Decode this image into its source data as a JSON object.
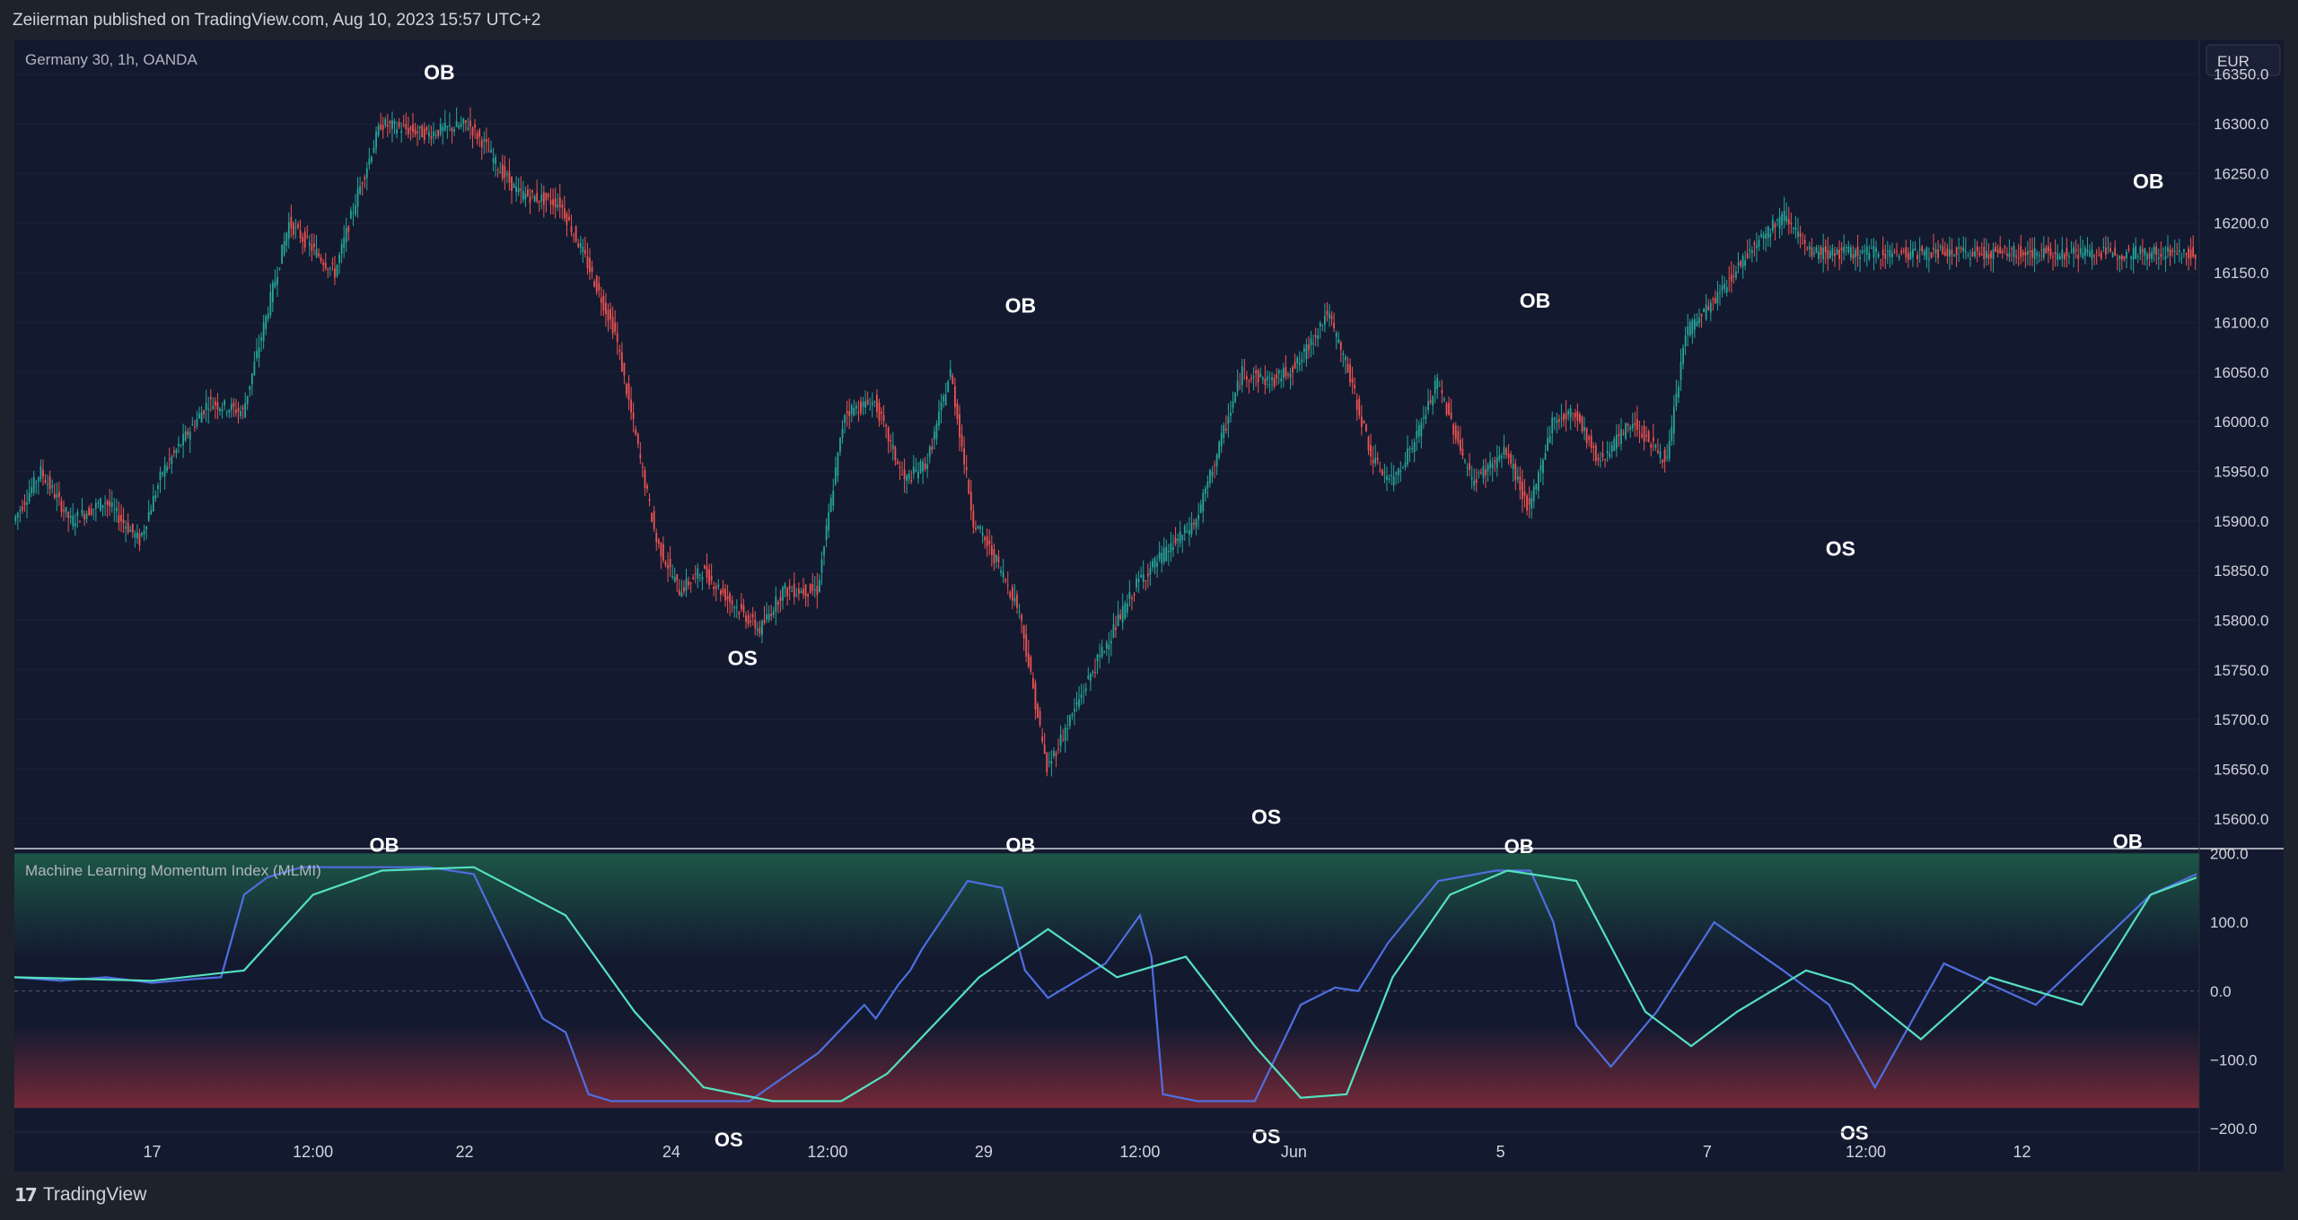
{
  "header": {
    "text": "Zeiierman published on TradingView.com, Aug 10, 2023 15:57 UTC+2"
  },
  "footer": {
    "brand": "TradingView",
    "logo_icon": "tv-logo-icon"
  },
  "colors": {
    "bg": "#131a30",
    "frame": "#1e222d",
    "text": "#d1d4dc",
    "up": "#26a69a",
    "down": "#ef5350",
    "mlmi_fast": "#4f6ee0",
    "mlmi_slow": "#55e0c0",
    "ob_zone": "#1d5a48",
    "os_zone": "#7a2a38"
  },
  "chart_data": [
    {
      "type": "candlestick",
      "title": "Germany 30, 1h, OANDA",
      "currency": "EUR",
      "ylim": [
        15570,
        16385
      ],
      "yticks": [
        "16350.0",
        "16300.0",
        "16250.0",
        "16200.0",
        "16150.0",
        "16100.0",
        "16050.0",
        "16000.0",
        "15950.0",
        "15900.0",
        "15850.0",
        "15800.0",
        "15750.0",
        "15700.0",
        "15650.0",
        "15600.0"
      ],
      "ytick_values": [
        16350,
        16300,
        16250,
        16200,
        16150,
        16100,
        16050,
        16000,
        15950,
        15900,
        15850,
        15800,
        15750,
        15700,
        15650,
        15600
      ],
      "path_index": [
        0,
        12,
        25,
        40,
        55,
        65,
        85,
        100,
        120,
        140,
        150,
        160,
        180,
        198,
        205,
        210,
        220,
        238,
        248,
        262,
        280,
        290,
        300,
        312,
        325,
        335,
        350,
        362,
        375,
        388,
        398,
        408,
        418,
        428,
        438,
        450,
        470,
        490,
        515,
        535,
        548,
        560,
        572,
        580,
        592,
        600,
        610,
        620,
        635,
        650,
        660,
        670,
        680,
        690,
        705,
        720,
        728,
        740,
        758,
        772,
        781
      ],
      "path_values": [
        15900,
        15950,
        15900,
        15920,
        15880,
        15950,
        16020,
        16010,
        16200,
        16150,
        16230,
        16300,
        16290,
        16300,
        16280,
        16260,
        16230,
        16220,
        16170,
        16090,
        15880,
        15830,
        15850,
        15820,
        15790,
        15830,
        15830,
        16010,
        16020,
        15940,
        15960,
        16050,
        15900,
        15860,
        15810,
        15650,
        15750,
        15840,
        15900,
        16050,
        16040,
        16060,
        16110,
        16060,
        15960,
        15940,
        15980,
        16040,
        15940,
        15970,
        15910,
        16000,
        16010,
        15960,
        16000,
        15960,
        16090,
        16120,
        16180,
        16210,
        16170
      ],
      "price_labels": [
        {
          "text": "OB",
          "i": 185,
          "v": 16345
        },
        {
          "text": "OS",
          "i": 317,
          "v": 15755
        },
        {
          "text": "OB",
          "i": 438,
          "v": 16110
        },
        {
          "text": "OS",
          "i": 545,
          "v": 15595
        },
        {
          "text": "OB",
          "i": 662,
          "v": 16115
        },
        {
          "text": "OS",
          "i": 795,
          "v": 15865
        },
        {
          "text": "OB",
          "i": 929,
          "v": 16235
        }
      ]
    },
    {
      "type": "line",
      "title": "Machine Learning Momentum Index (MLMI)",
      "ylim": [
        -205,
        207
      ],
      "yticks": [
        "200.0",
        "100.0",
        "0.0",
        "−100.0",
        "−200.0"
      ],
      "ytick_values": [
        200,
        100,
        0,
        -100,
        -200
      ],
      "zones": {
        "overbought": 180,
        "oversold": -170,
        "midline": 0
      },
      "series": [
        {
          "name": "",
          "x": [
            0,
            20,
            40,
            60,
            80,
            90,
            95,
            100,
            110,
            125,
            150,
            180,
            200,
            210,
            220,
            230,
            240,
            250,
            260,
            280,
            300,
            320,
            350,
            370,
            375,
            385,
            390,
            395,
            405,
            415,
            430,
            440,
            450,
            460,
            475,
            490,
            495,
            500,
            515,
            540,
            560,
            575,
            585,
            598,
            620,
            645,
            660,
            670,
            680,
            695,
            715,
            740,
            770,
            790,
            810,
            840,
            880,
            930,
            950
          ],
          "y": [
            20,
            15,
            20,
            12,
            18,
            20,
            80,
            140,
            165,
            180,
            180,
            180,
            170,
            100,
            30,
            -40,
            -60,
            -150,
            -160,
            -160,
            -160,
            -160,
            -90,
            -20,
            -40,
            10,
            30,
            60,
            110,
            160,
            150,
            30,
            -10,
            10,
            40,
            110,
            50,
            -150,
            -160,
            -160,
            -20,
            5,
            0,
            70,
            160,
            175,
            175,
            100,
            -50,
            -110,
            -30,
            100,
            30,
            -20,
            -140,
            40,
            -20,
            140,
            170
          ]
        },
        {
          "name": "",
          "x": [
            0,
            60,
            100,
            130,
            160,
            200,
            240,
            270,
            300,
            330,
            360,
            380,
            400,
            420,
            450,
            480,
            510,
            540,
            560,
            580,
            600,
            625,
            650,
            680,
            710,
            730,
            750,
            780,
            800,
            830,
            860,
            900,
            930,
            950
          ],
          "y": [
            20,
            15,
            30,
            140,
            175,
            180,
            110,
            -30,
            -140,
            -160,
            -160,
            -120,
            -50,
            20,
            90,
            20,
            50,
            -80,
            -155,
            -150,
            20,
            140,
            175,
            160,
            -30,
            -80,
            -30,
            30,
            10,
            -70,
            20,
            -20,
            140,
            165
          ]
        }
      ],
      "labels": [
        {
          "text": "OB",
          "i": 161,
          "v": 200
        },
        {
          "text": "OS",
          "i": 311,
          "v": -200
        },
        {
          "text": "OB",
          "i": 438,
          "v": 200
        },
        {
          "text": "OS",
          "i": 545,
          "v": -195
        },
        {
          "text": "OB",
          "i": 655,
          "v": 198
        },
        {
          "text": "OS",
          "i": 801,
          "v": -190
        },
        {
          "text": "OB",
          "i": 920,
          "v": 205
        }
      ]
    }
  ],
  "xaxis": {
    "ticks": [
      {
        "label": "17",
        "i": 60
      },
      {
        "label": "12:00",
        "i": 130
      },
      {
        "label": "22",
        "i": 196
      },
      {
        "label": "24",
        "i": 286
      },
      {
        "label": "12:00",
        "i": 354
      },
      {
        "label": "29",
        "i": 422
      },
      {
        "label": "12:00",
        "i": 490
      },
      {
        "label": "Jun",
        "i": 557
      },
      {
        "label": "5",
        "i": 647
      },
      {
        "label": "7",
        "i": 737
      },
      {
        "label": "12:00",
        "i": 806
      },
      {
        "label": "12",
        "i": 874
      }
    ]
  }
}
